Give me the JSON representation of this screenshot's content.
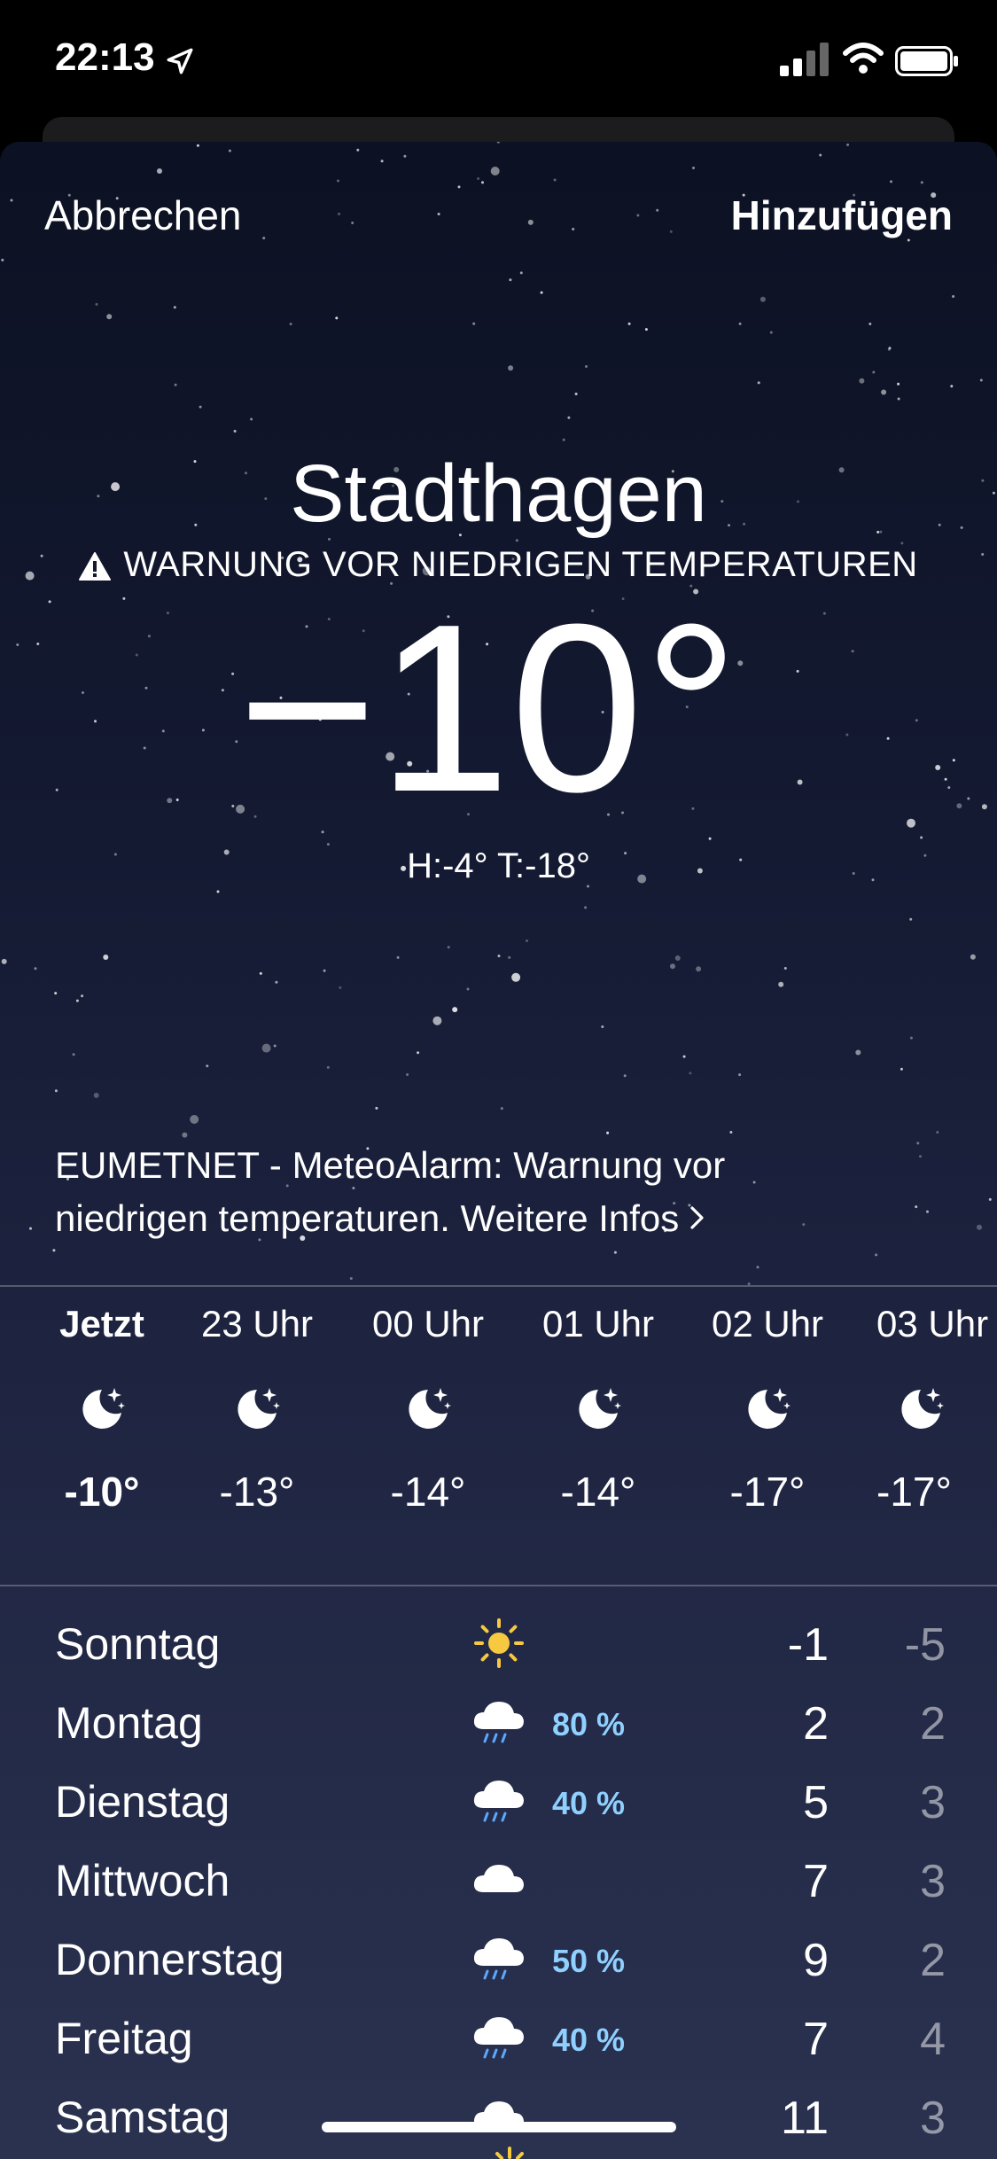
{
  "status_bar": {
    "time": "22:13"
  },
  "nav": {
    "cancel": "Abbrechen",
    "add": "Hinzufügen"
  },
  "location": {
    "city": "Stadthagen",
    "warning": "WARNUNG VOR NIEDRIGEN TEMPERATUREN",
    "temperature": "−10°",
    "hilo": "H:-4°  T:-18°"
  },
  "alert": {
    "text": "EUMETNET - MeteoAlarm: Warnung vor niedrigen temperaturen. Weitere Infos"
  },
  "hourly": [
    {
      "label": "Jetzt",
      "icon": "moon-stars-icon",
      "temp": "-10°"
    },
    {
      "label": "23 Uhr",
      "icon": "moon-stars-icon",
      "temp": "-13°"
    },
    {
      "label": "00 Uhr",
      "icon": "moon-stars-icon",
      "temp": "-14°"
    },
    {
      "label": "01 Uhr",
      "icon": "moon-stars-icon",
      "temp": "-14°"
    },
    {
      "label": "02 Uhr",
      "icon": "moon-stars-icon",
      "temp": "-17°"
    },
    {
      "label": "03 Uhr",
      "icon": "moon-stars-icon",
      "temp": "-17°"
    }
  ],
  "daily": [
    {
      "day": "Sonntag",
      "icon": "sun-icon",
      "prob": "",
      "hi": "-1",
      "lo": "-5"
    },
    {
      "day": "Montag",
      "icon": "cloud-rain-icon",
      "prob": "80 %",
      "hi": "2",
      "lo": "2"
    },
    {
      "day": "Dienstag",
      "icon": "cloud-rain-icon",
      "prob": "40 %",
      "hi": "5",
      "lo": "3"
    },
    {
      "day": "Mittwoch",
      "icon": "cloud-icon",
      "prob": "",
      "hi": "7",
      "lo": "3"
    },
    {
      "day": "Donnerstag",
      "icon": "cloud-rain-icon",
      "prob": "50 %",
      "hi": "9",
      "lo": "2"
    },
    {
      "day": "Freitag",
      "icon": "cloud-rain-icon",
      "prob": "40 %",
      "hi": "7",
      "lo": "4"
    },
    {
      "day": "Samstag",
      "icon": "cloud-icon",
      "prob": "",
      "hi": "11",
      "lo": "3"
    }
  ],
  "colors": {
    "sun": "#f6c940",
    "precip": "#8fd0ff",
    "rain_drops": "#5aa9ff"
  }
}
